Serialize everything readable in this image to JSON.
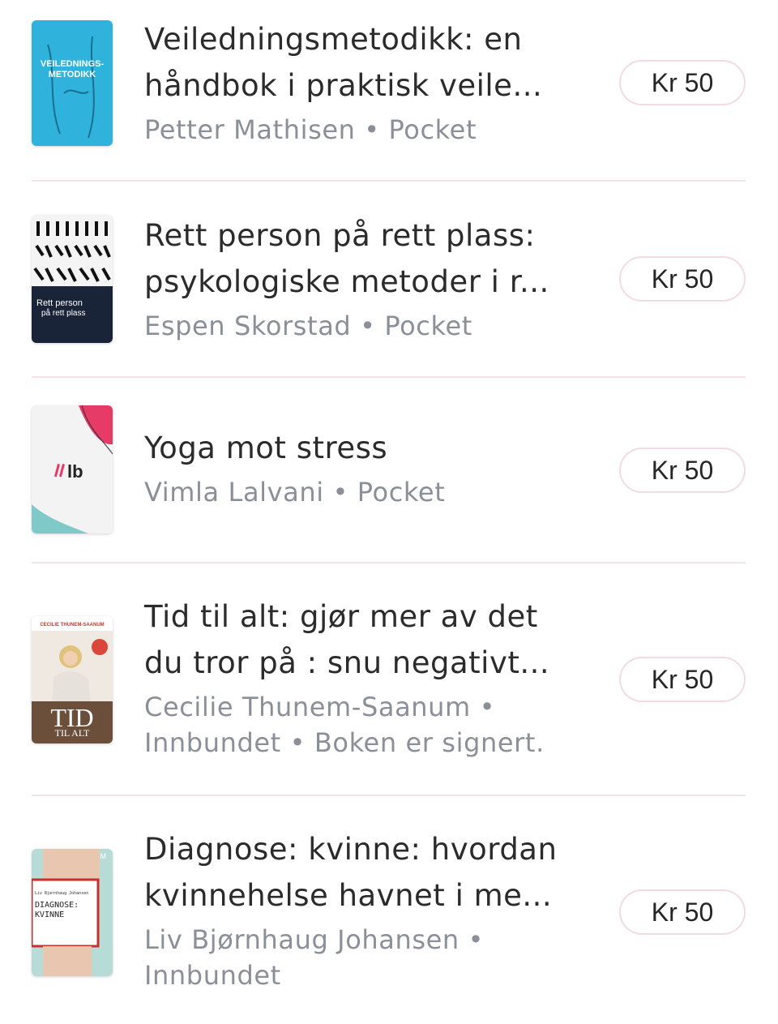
{
  "books": [
    {
      "title_line1": "Veiledningsmetodikk: en",
      "title_line2": "håndbok i praktisk veile...",
      "meta_line1": "Petter Mathisen • Pocket",
      "meta_line2": "",
      "price": "Kr 50",
      "cover_text": [
        "VEILEDNINGS-",
        "METODIKK"
      ]
    },
    {
      "title_line1": "Rett person på rett plass:",
      "title_line2": "psykologiske metoder i r...",
      "meta_line1": "Espen Skorstad • Pocket",
      "meta_line2": "",
      "price": "Kr 50",
      "cover_text": [
        "Rett person",
        "på rett plass"
      ]
    },
    {
      "title_line1": "Yoga mot stress",
      "title_line2": "",
      "meta_line1": "Vimla Lalvani • Pocket",
      "meta_line2": "",
      "price": "Kr 50",
      "cover_text": [
        "lb"
      ]
    },
    {
      "title_line1": "Tid til alt: gjør mer av det",
      "title_line2": "du tror på : snu negativt...",
      "meta_line1": "Cecilie Thunem-Saanum •",
      "meta_line2": "Innbundet • Boken er signert.",
      "price": "Kr 50",
      "cover_text": [
        "CECILIE THUNEM-SAANUM",
        "TID",
        "TIL ALT"
      ]
    },
    {
      "title_line1": "Diagnose: kvinne: hvordan",
      "title_line2": "kvinnehelse havnet i me...",
      "meta_line1": "Liv Bjørnhaug Johansen •",
      "meta_line2": "Innbundet",
      "price": "Kr 50",
      "cover_text": [
        "Liv Bjørnhaug Johansen",
        "DIAGNOSE:",
        "KVINNE"
      ]
    }
  ]
}
